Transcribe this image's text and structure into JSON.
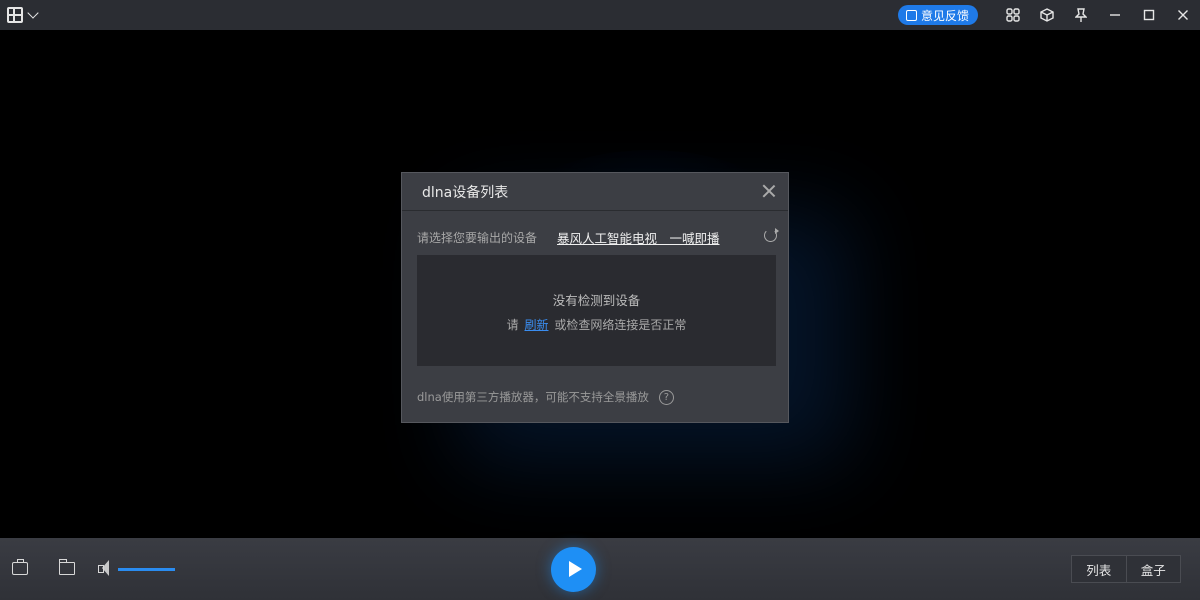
{
  "titlebar": {
    "feedback_label": "意见反馈",
    "icons": [
      "menu-icon",
      "chevron-down-icon",
      "feedback-icon",
      "apps-icon",
      "cube-icon",
      "pin-icon",
      "minimize-icon",
      "maximize-icon",
      "close-icon"
    ]
  },
  "dialog": {
    "title": "dlna设备列表",
    "prompt": "请选择您要输出的设备",
    "promo_link": "暴风人工智能电视　一喊即播",
    "empty_text": "没有检测到设备",
    "hint_before": "请",
    "hint_link": "刷新",
    "hint_after": "或检查网络连接是否正常",
    "footer_note": "dlna使用第三方播放器，可能不支持全景播放",
    "help_symbol": "?"
  },
  "bottombar": {
    "volume_level": 1.0,
    "tabs": [
      {
        "label": "列表"
      },
      {
        "label": "盒子"
      }
    ]
  },
  "colors": {
    "accent": "#1e8ff5",
    "link": "#3a8df0",
    "titlebar_bg": "#2b2d33",
    "dialog_bg": "#3c3e44"
  }
}
